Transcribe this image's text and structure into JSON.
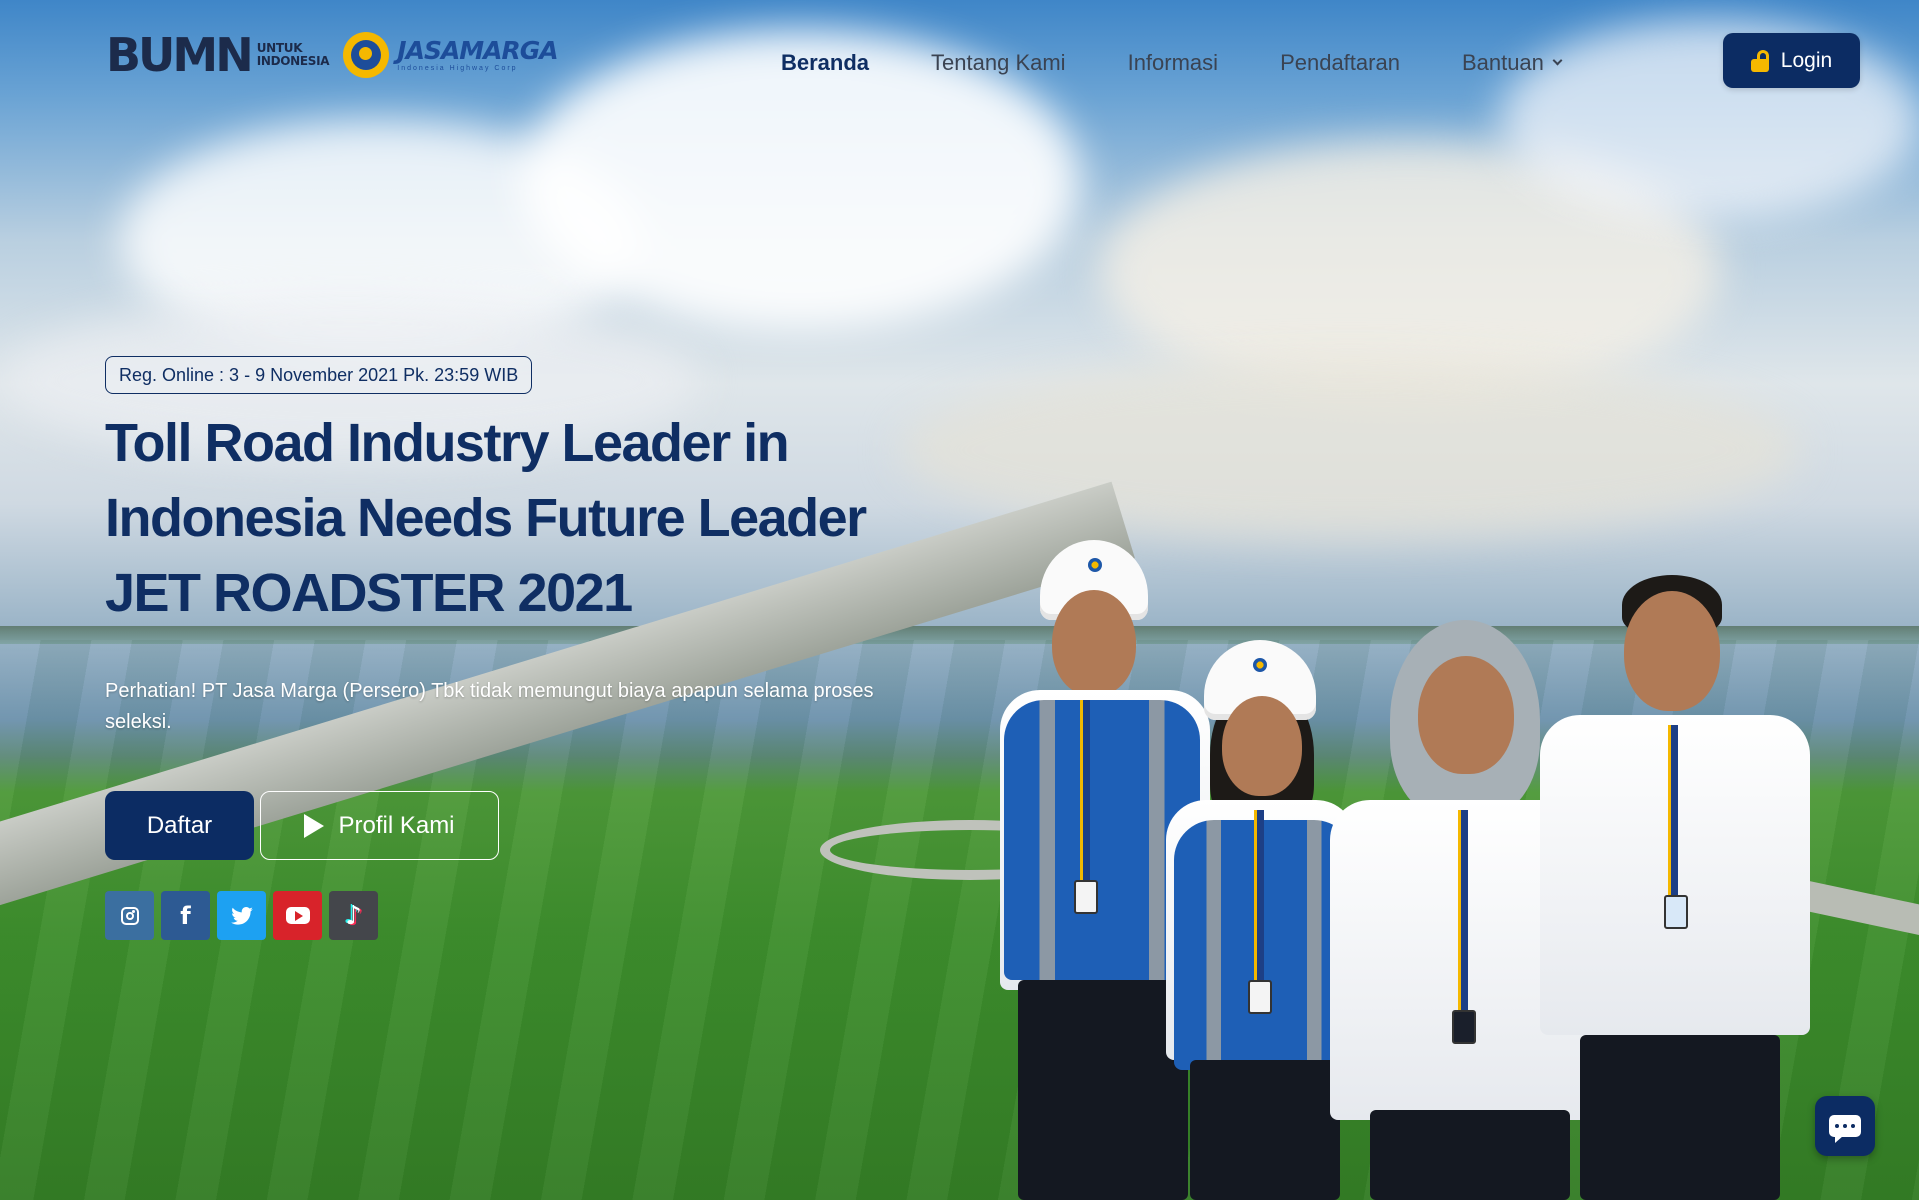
{
  "brand": {
    "bumn_mark": "BUMN",
    "bumn_sub_line1": "UNTUK",
    "bumn_sub_line2": "INDONESIA",
    "company_name": "JASAMARGA",
    "company_tagline": "Indonesia Highway Corp",
    "colors": {
      "navy": "#0c2c63",
      "heading": "#0f2e63",
      "gold": "#f5b800",
      "blue": "#1d4d9a"
    }
  },
  "nav": {
    "items": [
      {
        "label": "Beranda",
        "active": true
      },
      {
        "label": "Tentang Kami",
        "active": false
      },
      {
        "label": "Informasi",
        "active": false
      },
      {
        "label": "Pendaftaran",
        "active": false
      },
      {
        "label": "Bantuan",
        "active": false,
        "has_dropdown": true
      }
    ],
    "login_label": "Login",
    "login_icon": "lock-icon"
  },
  "hero": {
    "registration_badge": "Reg. Online : 3 - 9 November 2021 Pk. 23:59 WIB",
    "headline": [
      "Toll Road Industry Leader in",
      "Indonesia Needs Future Leader",
      "JET ROADSTER 2021"
    ],
    "notice": "Perhatian! PT Jasa Marga (Persero) Tbk tidak memungut biaya apapun selama proses seleksi.",
    "primary_button": "Daftar",
    "secondary_button": "Profil Kami",
    "secondary_icon": "play-icon"
  },
  "socials": [
    {
      "network": "instagram",
      "icon": "instagram-icon",
      "color": "#3b6fa0"
    },
    {
      "network": "facebook",
      "icon": "facebook-icon",
      "color": "#2d5a93"
    },
    {
      "network": "twitter",
      "icon": "twitter-icon",
      "color": "#1da1f2"
    },
    {
      "network": "youtube",
      "icon": "youtube-icon",
      "color": "#d8232a"
    },
    {
      "network": "tiktok",
      "icon": "tiktok-icon",
      "color": "#44464b"
    }
  ],
  "chat_widget": {
    "icon": "chat-icon"
  }
}
